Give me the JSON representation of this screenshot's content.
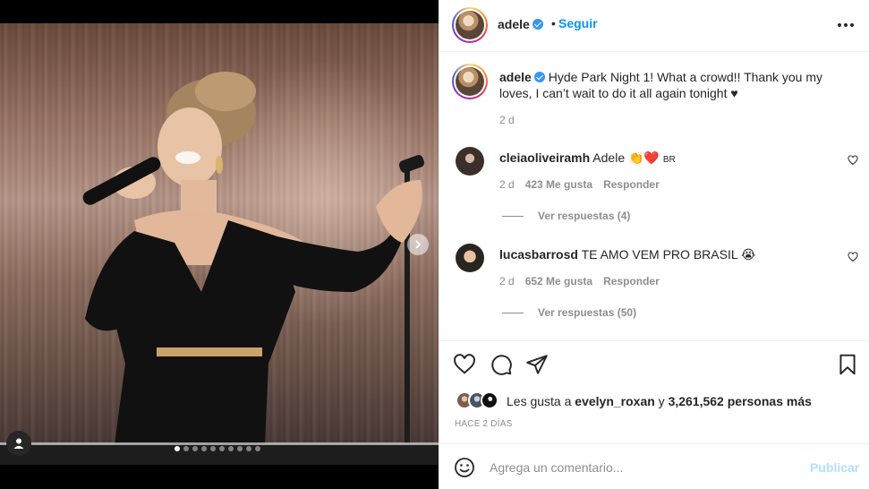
{
  "post": {
    "username": "adele",
    "separator": "•",
    "follow_label": "Seguir",
    "caption": "Hyde Park Night 1! What a crowd!! Thank you my loves, I can’t wait to do it all again tonight ♥",
    "caption_time": "2 d"
  },
  "media": {
    "carousel_total": 10,
    "carousel_active": 1,
    "icons": {
      "next": "chevron-right-icon",
      "user_tag": "person-icon"
    }
  },
  "comments": [
    {
      "username": "cleiaoliveiramh",
      "text": "Adele 👏❤️",
      "flag": "BR",
      "time": "2 d",
      "likes": "423 Me gusta",
      "reply_label": "Responder",
      "view_replies": "Ver respuestas (4)"
    },
    {
      "username": "lucasbarrosd",
      "text": "TE AMO VEM PRO BRASIL 😭",
      "flag": "",
      "time": "2 d",
      "likes": "652 Me gusta",
      "reply_label": "Responder",
      "view_replies": "Ver respuestas (50)"
    }
  ],
  "actions": {
    "icons": [
      "heart-icon",
      "comment-icon",
      "share-icon",
      "bookmark-icon"
    ],
    "likes_prefix": "Les gusta a",
    "likes_user": "evelyn_roxan",
    "likes_middle": "y",
    "likes_count": "3,261,562 personas más",
    "post_time": "HACE 2 DÍAS"
  },
  "add_comment": {
    "placeholder": "Agrega un comentario...",
    "publish_label": "Publicar"
  },
  "colors": {
    "link": "#0095f6",
    "text": "#262626",
    "muted": "#8e8e8e",
    "publish_disabled": "#b2dffc",
    "verified": "#3897f0"
  }
}
